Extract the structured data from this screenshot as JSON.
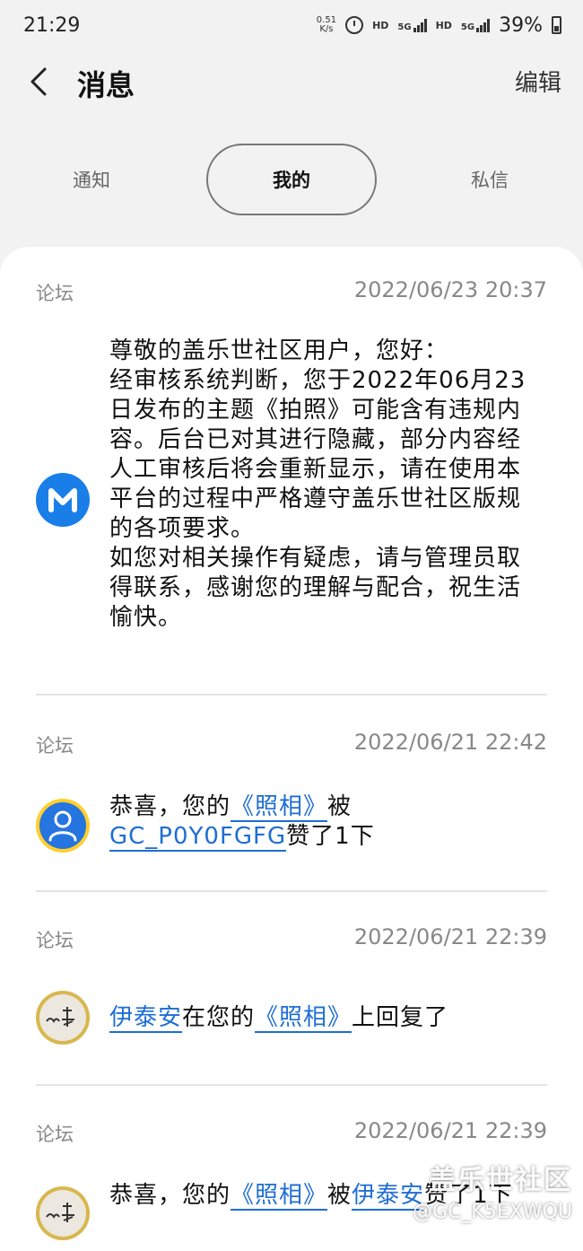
{
  "status_bar": {
    "time": "21:29",
    "speed_value": "0.51",
    "speed_unit": "K/s",
    "hd1": "HD",
    "net1": "5G",
    "hd2": "HD",
    "net2": "5G",
    "battery": "39%"
  },
  "header": {
    "title": "消息",
    "edit_label": "编辑"
  },
  "tabs": [
    {
      "label": "通知",
      "selected": false
    },
    {
      "label": "我的",
      "selected": true
    },
    {
      "label": "私信",
      "selected": false
    }
  ],
  "messages": [
    {
      "category": "论坛",
      "time": "2022/06/23 20:37",
      "avatar": "m-logo-icon",
      "lines": [
        "尊敬的盖乐世社区用户，您好：",
        "经审核系统判断，您于2022年06月23日发布的主题《拍照》可能含有违规内容。后台已对其进行隐藏，部分内容经人工审核后将会重新显示，请在使用本平台的过程中严格遵守盖乐世社区版规的各项要求。",
        "如您对相关操作有疑虑，请与管理员取得联系，感谢您的理解与配合，祝生活愉快。"
      ]
    },
    {
      "category": "论坛",
      "time": "2022/06/21 22:42",
      "avatar": "user-icon",
      "prefix": "恭喜，您的",
      "post_link": "《照相》",
      "middle": "被",
      "user_link": "GC_P0Y0FGFG",
      "suffix": "赞了1下"
    },
    {
      "category": "论坛",
      "time": "2022/06/21 22:39",
      "avatar": "photo-avatar",
      "user_link": "伊泰安",
      "middle": "在您的",
      "post_link": "《照相》",
      "suffix": "上回复了"
    },
    {
      "category": "论坛",
      "time": "2022/06/21 22:39",
      "avatar": "photo-avatar",
      "prefix": "恭喜，您的",
      "post_link": "《照相》",
      "middle": "被",
      "user_link": "伊泰安",
      "suffix": "赞了1下"
    }
  ],
  "watermark": {
    "brand": "盖乐世社区",
    "user": "@GC_K5EXWQU"
  }
}
